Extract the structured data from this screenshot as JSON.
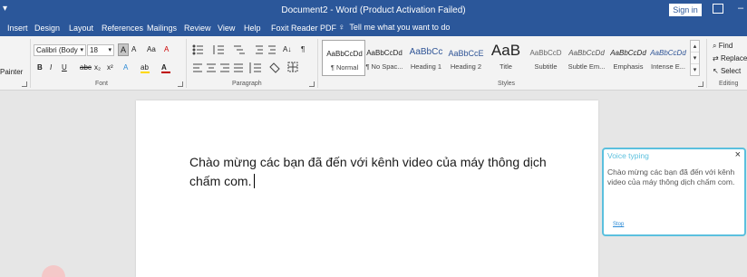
{
  "titlebar": {
    "title": "Document2  -  Word (Product Activation Failed)",
    "signin": "Sign in",
    "quick_access_glyph": "▾",
    "minimize_glyph": "–"
  },
  "tabs": [
    "Insert",
    "Design",
    "Layout",
    "References",
    "Mailings",
    "Review",
    "View",
    "Help",
    "Foxit Reader PDF"
  ],
  "tell_me": "Tell me what you want to do",
  "clipboard": {
    "painter_label": "Painter"
  },
  "font": {
    "family": "Calibri (Body",
    "size": "18",
    "grow": "A",
    "shrink": "A",
    "case": "Aa",
    "clear": "A",
    "bold": "B",
    "italic": "I",
    "underline": "U",
    "strike": "abc",
    "subscript": "x₂",
    "superscript": "x²",
    "effects": "A",
    "highlight": "ab",
    "color": "A",
    "group_label": "Font"
  },
  "paragraph": {
    "group_label": "Paragraph",
    "sort": "A↓",
    "marks": "¶"
  },
  "styles": {
    "group_label": "Styles",
    "items": [
      {
        "sample": "AaBbCcDd",
        "name": "¶ Normal"
      },
      {
        "sample": "AaBbCcDd",
        "name": "¶ No Spac..."
      },
      {
        "sample": "AaBbCc",
        "name": "Heading 1"
      },
      {
        "sample": "AaBbCcE",
        "name": "Heading 2"
      },
      {
        "sample": "AaB",
        "name": "Title"
      },
      {
        "sample": "AaBbCcD",
        "name": "Subtitle"
      },
      {
        "sample": "AaBbCcDd",
        "name": "Subtle Em..."
      },
      {
        "sample": "AaBbCcDd",
        "name": "Emphasis"
      },
      {
        "sample": "AaBbCcDd",
        "name": "Intense E..."
      }
    ]
  },
  "editing": {
    "find": "Find",
    "replace": "Replace",
    "select": "Select",
    "group_label": "Editing"
  },
  "document": {
    "line1": "Chào mừng các bạn đã đến với kênh video của máy thông dịch",
    "line2": "chấm com."
  },
  "voice_typing": {
    "title": "Voice typing",
    "close": "×",
    "text": "Chào mừng các bạn đã đến với kênh video của máy thông dịch chấm com.",
    "link": "Stop"
  },
  "colors": {
    "brand": "#2b579a",
    "voice_accent": "#5bc0de"
  }
}
